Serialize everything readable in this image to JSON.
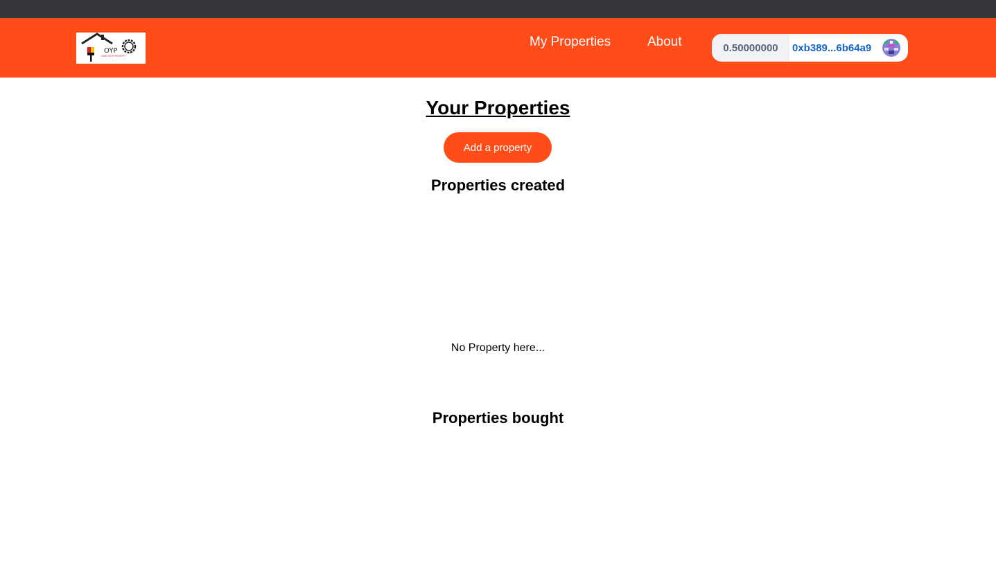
{
  "colors": {
    "browser_bar": "#35363a",
    "brand": "#ff4c19",
    "wallet_balance_bg": "#f0f2f6",
    "wallet_balance_text": "#5b6579",
    "wallet_address_text": "#1668c6"
  },
  "header": {
    "logo": {
      "text": "OYP",
      "tagline": "OWN YOUR PROPERTY"
    },
    "nav": [
      {
        "label": "My Properties"
      },
      {
        "label": "About"
      }
    ],
    "wallet": {
      "balance": "0.50000000",
      "address": "0xb389...6b64a9",
      "avatar_icon": "identicon-avatar"
    }
  },
  "main": {
    "title": "Your Properties",
    "add_button_label": "Add a property",
    "created": {
      "title": "Properties created",
      "empty_message": "No Property here..."
    },
    "bought": {
      "title": "Properties bought"
    }
  }
}
